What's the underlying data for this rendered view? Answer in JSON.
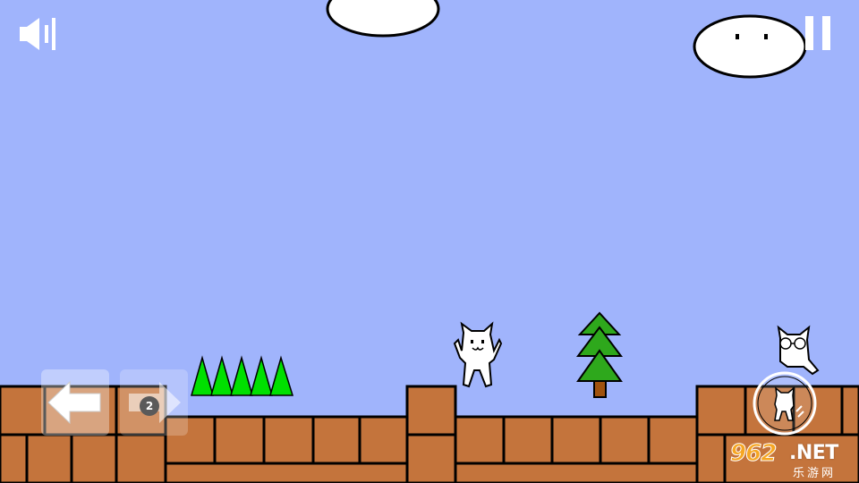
{
  "hud": {
    "sound_icon": "speaker-icon",
    "pause_icon": "pause-icon"
  },
  "controls": {
    "left_icon": "arrow-left-icon",
    "right_icon": "arrow-right-icon",
    "right_badge": "2",
    "jump_icon": "cat-jump-icon"
  },
  "watermark": {
    "number": "962",
    "domain": ".NET",
    "subtitle": "乐游网"
  },
  "colors": {
    "sky": "#a0b4fc",
    "brick": "#c4743c",
    "brick_line": "#000000",
    "spikes": "#00e000",
    "tree": "#2ea81c",
    "trunk": "#a0520e",
    "cloud": "#ffffff"
  }
}
